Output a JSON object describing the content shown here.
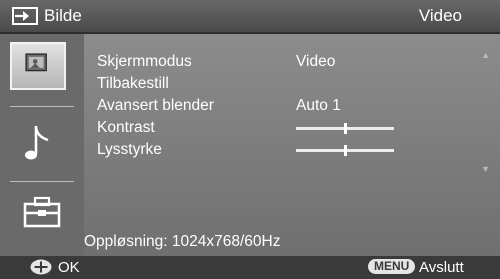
{
  "header": {
    "title": "Bilde",
    "right_label": "Video",
    "source_icon": "input-source-icon"
  },
  "sidebar": {
    "items": [
      {
        "icon": "picture-icon",
        "active": true
      },
      {
        "icon": "music-note-icon",
        "active": false
      },
      {
        "icon": "toolbox-icon",
        "active": false
      }
    ]
  },
  "menu": {
    "rows": [
      {
        "label": "Skjermmodus",
        "value": "Video"
      },
      {
        "label": "Tilbakestill",
        "value": ""
      },
      {
        "label": "Avansert blender",
        "value": "Auto 1"
      },
      {
        "label": "Kontrast",
        "slider_level": 0.5
      },
      {
        "label": "Lysstyrke",
        "slider_level": 0.5
      }
    ]
  },
  "status": {
    "resolution": "Oppløsning: 1024x768/60Hz"
  },
  "footer": {
    "enter_icon": "enter-dpad-icon",
    "ok_label": "OK",
    "menu_key": "MENU",
    "exit_label": "Avslutt"
  },
  "colors": {
    "panel": "#7e7e7e",
    "header": "#555555",
    "footer": "#3a3a3a",
    "text": "#ffffff"
  }
}
